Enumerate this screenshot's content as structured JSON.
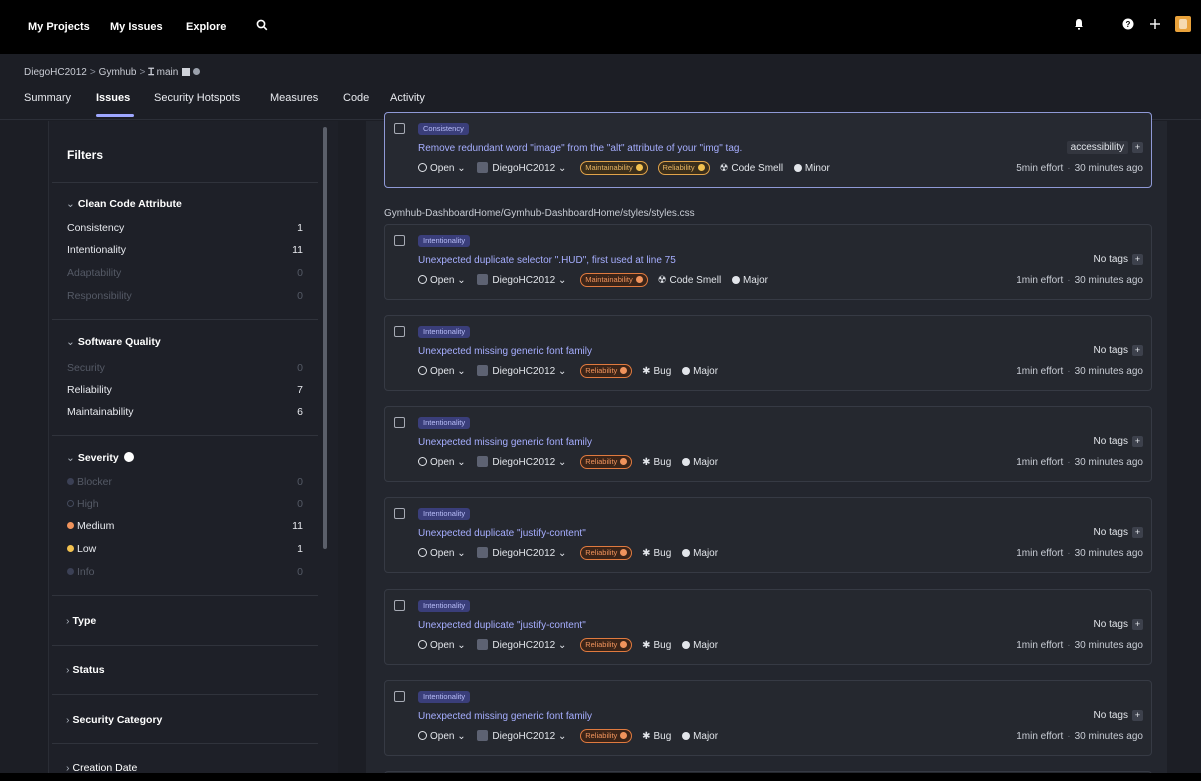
{
  "topnav": {
    "links": [
      "My Projects",
      "My Issues",
      "Explore"
    ],
    "icons": [
      "search-icon",
      "bell-icon",
      "help-icon",
      "plus-icon",
      "avatar"
    ]
  },
  "breadcrumb": {
    "org": "DiegoHC2012",
    "project": "Gymhub",
    "branch": "main",
    "separator": ">"
  },
  "tabs": [
    "Summary",
    "Issues",
    "Security Hotspots",
    "Measures",
    "Code",
    "Activity"
  ],
  "sidebar": {
    "title": "Filters",
    "clean_code": {
      "title": "Clean Code Attribute",
      "items": [
        {
          "label": "Consistency",
          "count": "1"
        },
        {
          "label": "Intentionality",
          "count": "11"
        },
        {
          "label": "Adaptability",
          "count": "0"
        },
        {
          "label": "Responsibility",
          "count": "0"
        }
      ]
    },
    "software_quality": {
      "title": "Software Quality",
      "items": [
        {
          "label": "Security",
          "count": "0"
        },
        {
          "label": "Reliability",
          "count": "7"
        },
        {
          "label": "Maintainability",
          "count": "6"
        }
      ]
    },
    "severity": {
      "title": "Severity",
      "items": [
        {
          "label": "Blocker",
          "count": "0"
        },
        {
          "label": "High",
          "count": "0"
        },
        {
          "label": "Medium",
          "count": "11"
        },
        {
          "label": "Low",
          "count": "1"
        },
        {
          "label": "Info",
          "count": "0"
        }
      ]
    },
    "collapsed": [
      "Type",
      "Status",
      "Security Category",
      "Creation Date"
    ]
  },
  "colors": {
    "accent": "#9ea7ff",
    "maintainability": "#e0a34a",
    "reliability": "#e07a3f",
    "medium": "#f0935c",
    "low": "#f2c14f"
  },
  "file_path": "Gymhub-DashboardHome/Gymhub-DashboardHome/styles/styles.css",
  "issues": [
    {
      "attribute": "Consistency",
      "message": "Remove redundant word \"image\" from the \"alt\" attribute of your \"img\" tag.",
      "status": "Open",
      "assignee": "DiegoHC2012",
      "qualities": [
        "Maintainability",
        "Reliability"
      ],
      "type": "Code Smell",
      "severity": "Minor",
      "tags": "accessibility",
      "effort": "5min effort",
      "age": "30 minutes ago"
    },
    {
      "attribute": "Intentionality",
      "message": "Unexpected duplicate selector \".HUD\", first used at line 75",
      "status": "Open",
      "assignee": "DiegoHC2012",
      "qualities": [
        "Maintainability"
      ],
      "type": "Code Smell",
      "severity": "Major",
      "tags": "No tags",
      "effort": "1min effort",
      "age": "30 minutes ago"
    },
    {
      "attribute": "Intentionality",
      "message": "Unexpected missing generic font family",
      "status": "Open",
      "assignee": "DiegoHC2012",
      "qualities": [
        "Reliability"
      ],
      "type": "Bug",
      "severity": "Major",
      "tags": "No tags",
      "effort": "1min effort",
      "age": "30 minutes ago"
    },
    {
      "attribute": "Intentionality",
      "message": "Unexpected missing generic font family",
      "status": "Open",
      "assignee": "DiegoHC2012",
      "qualities": [
        "Reliability"
      ],
      "type": "Bug",
      "severity": "Major",
      "tags": "No tags",
      "effort": "1min effort",
      "age": "30 minutes ago"
    },
    {
      "attribute": "Intentionality",
      "message": "Unexpected duplicate \"justify-content\"",
      "status": "Open",
      "assignee": "DiegoHC2012",
      "qualities": [
        "Reliability"
      ],
      "type": "Bug",
      "severity": "Major",
      "tags": "No tags",
      "effort": "1min effort",
      "age": "30 minutes ago"
    },
    {
      "attribute": "Intentionality",
      "message": "Unexpected duplicate \"justify-content\"",
      "status": "Open",
      "assignee": "DiegoHC2012",
      "qualities": [
        "Reliability"
      ],
      "type": "Bug",
      "severity": "Major",
      "tags": "No tags",
      "effort": "1min effort",
      "age": "30 minutes ago"
    },
    {
      "attribute": "Intentionality",
      "message": "Unexpected missing generic font family",
      "status": "Open",
      "assignee": "DiegoHC2012",
      "qualities": [
        "Reliability"
      ],
      "type": "Bug",
      "severity": "Major",
      "tags": "No tags",
      "effort": "1min effort",
      "age": "30 minutes ago"
    }
  ]
}
